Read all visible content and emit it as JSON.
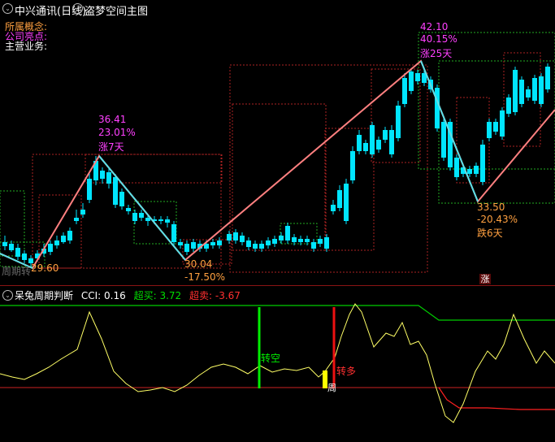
{
  "header": {
    "title": "中兴通讯(日线)",
    "formula": "盗梦空间主图"
  },
  "info_panel": {
    "concept_label": "所属概念:",
    "highlight_label": "公司亮点:",
    "business_label": "主营业务:"
  },
  "chart_data": {
    "type": "candlestick",
    "swing_labels": [
      {
        "price": "36.41",
        "pct": "23.01%",
        "days": "涨7天"
      },
      {
        "price": "30.04",
        "pct": "-17.50%"
      },
      {
        "price": "42.10",
        "pct": "40.15%",
        "days": "涨25天"
      },
      {
        "price": "33.50",
        "pct": "-20.43%",
        "days": "跌6天"
      },
      {
        "price": "29.60"
      }
    ],
    "period_label": "周期转",
    "badge_zhang": "涨"
  },
  "indicator": {
    "name": "呆兔周期判断",
    "cci_label": "CCI:",
    "cci_value": "0.16",
    "overbought_label": "超买:",
    "overbought_value": "3.72",
    "oversold_label": "超卖:",
    "oversold_value": "-3.67",
    "signal_short": "转空",
    "signal_long": "转多",
    "signal_week": "周"
  },
  "colors": {
    "up": "#ff4a4a",
    "down": "#00e5ff",
    "zigzag_up": "#ff8080",
    "zigzag_down": "#5ae0e8",
    "magenta": "#ff40ff",
    "orange": "#ffa040",
    "cci": "#ffff66",
    "green": "#00cc00",
    "red": "#ff2020"
  }
}
